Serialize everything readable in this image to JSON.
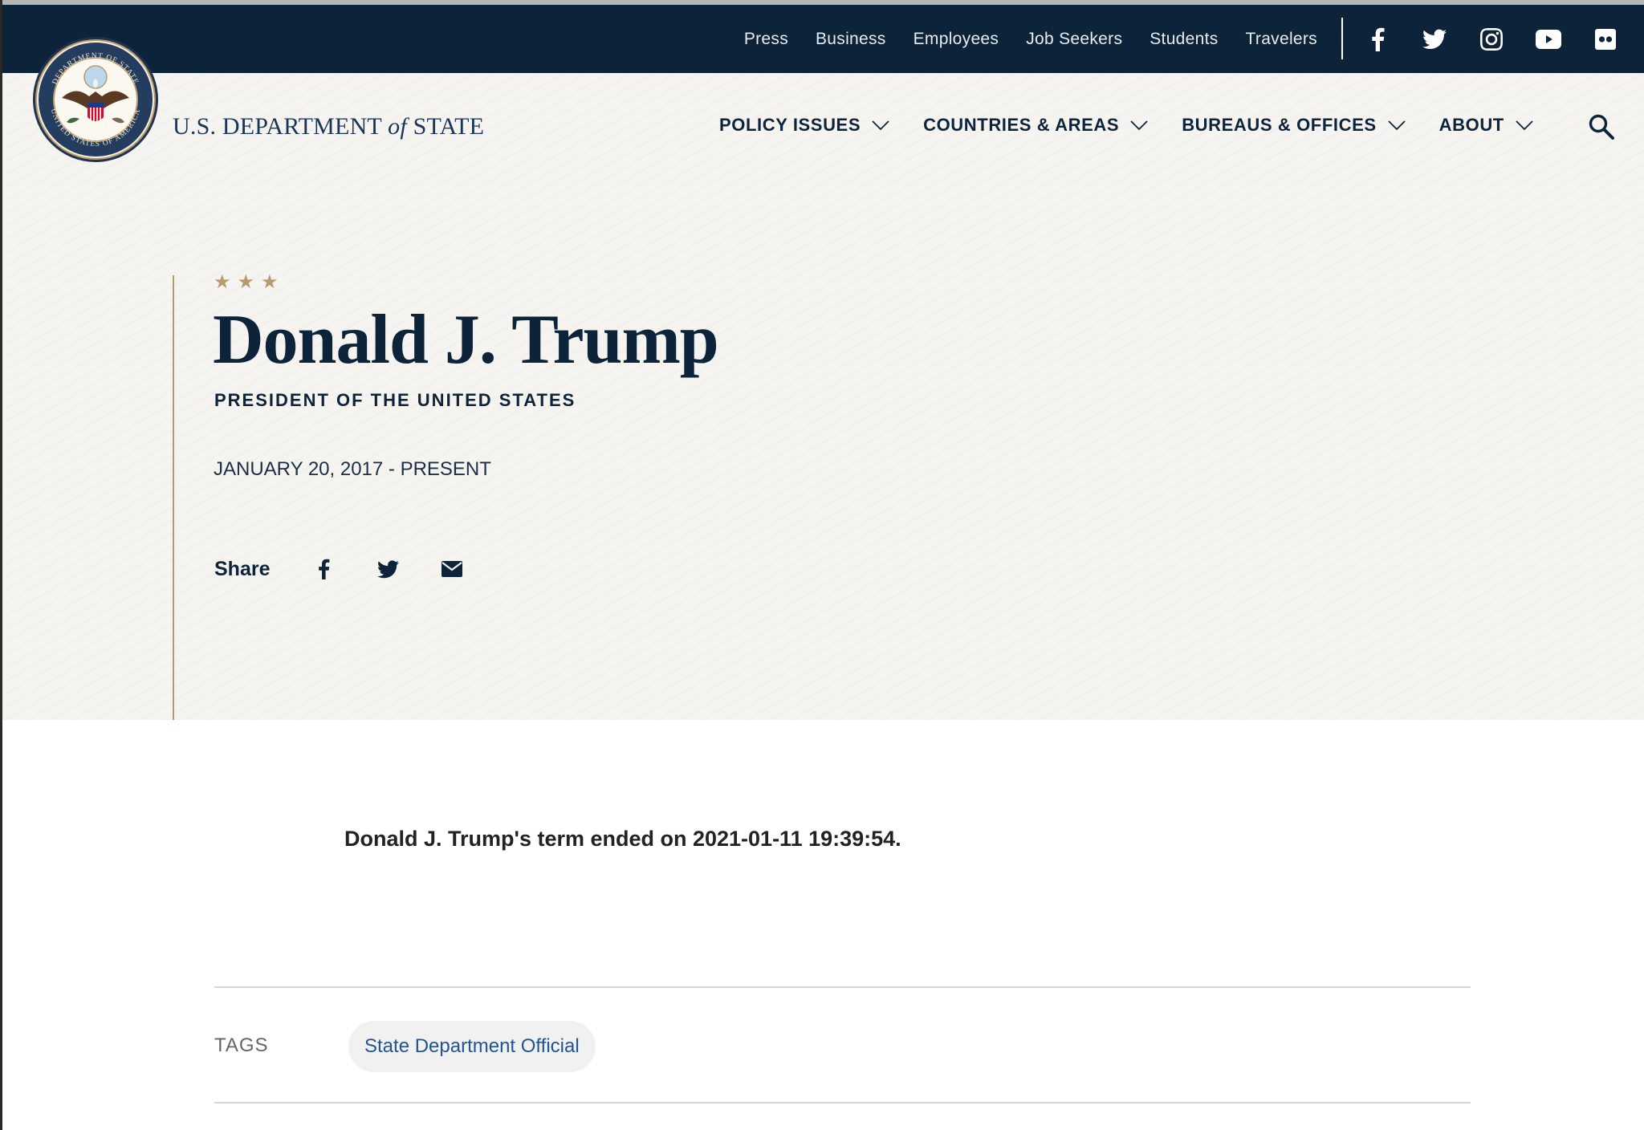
{
  "top_bar": {
    "links": [
      "Press",
      "Business",
      "Employees",
      "Job Seekers",
      "Students",
      "Travelers"
    ],
    "social_icons": [
      "facebook-icon",
      "twitter-icon",
      "instagram-icon",
      "youtube-icon",
      "flickr-icon"
    ]
  },
  "header": {
    "seal": "department-of-state-seal",
    "seal_text": "DEPARTMENT OF STATE · UNITED STATES OF AMERICA",
    "wordmark_prefix": "U.S. DEPARTMENT ",
    "wordmark_of": "of",
    "wordmark_suffix": " STATE",
    "nav": [
      "POLICY ISSUES",
      "COUNTRIES & AREAS",
      "BUREAUS & OFFICES",
      "ABOUT"
    ],
    "search_icon": "search-icon"
  },
  "hero": {
    "stars": "★★★",
    "name": "Donald J. Trump",
    "title": "PRESIDENT OF THE UNITED STATES",
    "dates": "JANUARY 20, 2017 - PRESENT",
    "share_label": "Share",
    "share_icons": [
      "facebook-icon",
      "twitter-icon",
      "email-icon"
    ]
  },
  "content": {
    "term_note": "Donald J. Trump's term ended on 2021-01-11 19:39:54.",
    "tags_label": "TAGS",
    "tags": [
      "State Department Official"
    ]
  },
  "colors": {
    "navy": "#0d2339",
    "gold": "#b89a6f",
    "hero_bg": "#f5f4f1",
    "link_blue": "#205493"
  }
}
